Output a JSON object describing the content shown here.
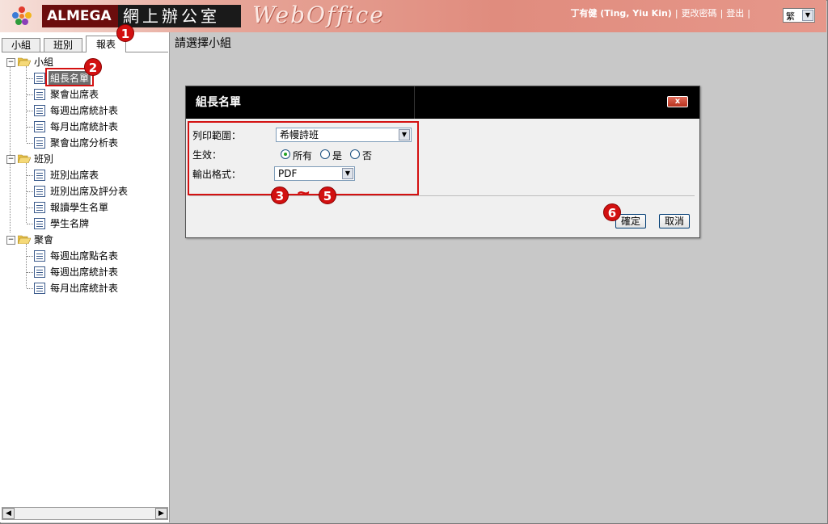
{
  "header": {
    "brand": "ALMEGA",
    "brand_cn": "網上辦公室",
    "product": "WebOffice",
    "user": "丁有健 (Ting, Yiu Kin)",
    "change_password": "更改密碼",
    "logout": "登出",
    "language": "繁"
  },
  "tabs": [
    {
      "label": "小組"
    },
    {
      "label": "班別"
    },
    {
      "label": "報表"
    }
  ],
  "tree": {
    "groups": [
      {
        "label": "小組",
        "items": [
          "組長名單",
          "聚會出席表",
          "每週出席統計表",
          "每月出席統計表",
          "聚會出席分析表"
        ]
      },
      {
        "label": "班別",
        "items": [
          "班別出席表",
          "班別出席及評分表",
          "報讀學生名單",
          "學生名牌"
        ]
      },
      {
        "label": "聚會",
        "items": [
          "每週出席點名表",
          "每週出席統計表",
          "每月出席統計表"
        ]
      }
    ]
  },
  "main": {
    "heading": "請選擇小組"
  },
  "dialog": {
    "title": "組長名單",
    "close_label": "x",
    "print_range_label": "列印範圍：",
    "print_range_value": "希幔詩班",
    "effective_label": "生效：",
    "radio_all": "所有",
    "radio_yes": "是",
    "radio_no": "否",
    "format_label": "輸出格式：",
    "format_value": "PDF",
    "ok_label": "確定",
    "cancel_label": "取消"
  },
  "annotations": {
    "b1": "1",
    "b2": "2",
    "b3": "3",
    "b5": "5",
    "b6": "6",
    "tilde": "~"
  },
  "colors": {
    "annotation_red": "#d21010",
    "dialog_title_bg": "#000000",
    "header_bg": "#e08c7e"
  }
}
